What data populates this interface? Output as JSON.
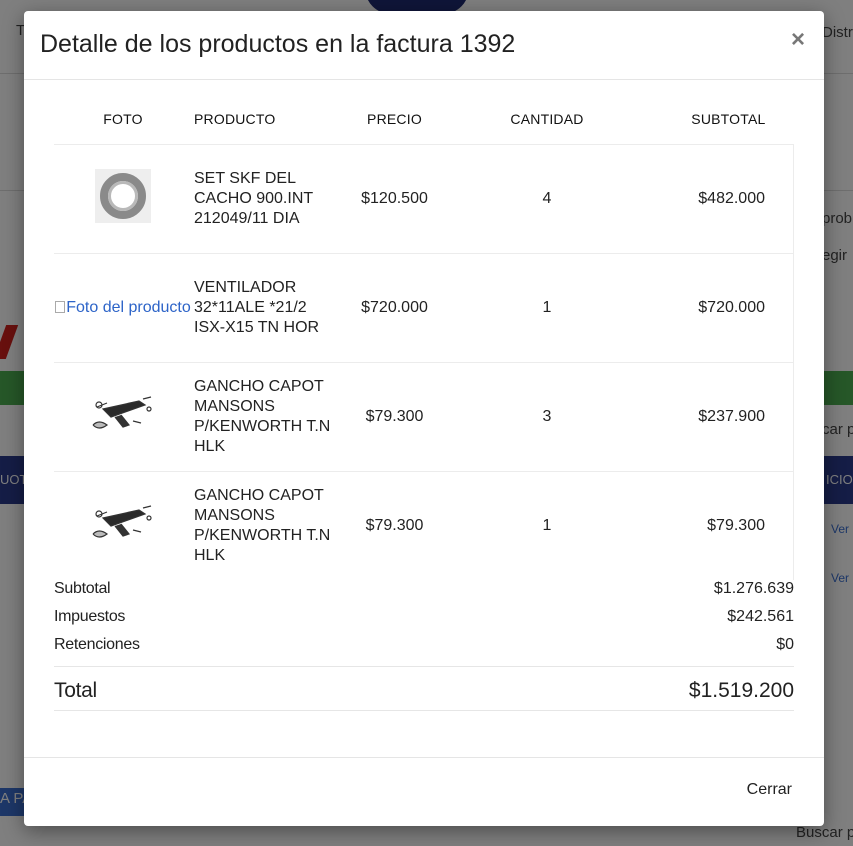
{
  "background": {
    "top_left": "T",
    "top_right": "Distr",
    "right_1": "prob",
    "right_2": "egir",
    "right_3": "car p",
    "navy_left": "UOT",
    "navy_right": "ICIO",
    "link_1": "Ver",
    "link_2": "Ver",
    "bottom_left": "A PA",
    "bottom_right": "Buscar p"
  },
  "modal": {
    "title": "Detalle de los productos en la factura 1392",
    "close_icon": "×",
    "close_button_label": "Cerrar"
  },
  "table": {
    "headers": [
      "FOTO",
      "PRODUCTO",
      "PRECIO",
      "CANTIDAD",
      "SUBTOTAL"
    ],
    "rows": [
      {
        "image": "bearing-photo",
        "product": "SET SKF DEL CACHO 900.INT 212049/11 DIA",
        "price": "$120.500",
        "qty": "4",
        "subtotal": "$482.000"
      },
      {
        "image": "broken",
        "image_alt": "Foto del producto",
        "product": "VENTILADOR 32*11ALE *21/2 ISX-X15 TN HOR",
        "price": "$720.000",
        "qty": "1",
        "subtotal": "$720.000"
      },
      {
        "image": "hood-hook-diagram",
        "product": "GANCHO CAPOT MANSONS P/KENWORTH T.N HLK",
        "price": "$79.300",
        "qty": "3",
        "subtotal": "$237.900"
      },
      {
        "image": "hood-hook-diagram",
        "product": "GANCHO CAPOT MANSONS P/KENWORTH T.N HLK",
        "price": "$79.300",
        "qty": "1",
        "subtotal": "$79.300"
      }
    ]
  },
  "totals": {
    "subtotal_label": "Subtotal",
    "subtotal": "$1.276.639",
    "taxes_label": "Impuestos",
    "taxes": "$242.561",
    "withholdings_label": "Retenciones",
    "withholdings": "$0",
    "total_label": "Total",
    "total": "$1.519.200"
  }
}
